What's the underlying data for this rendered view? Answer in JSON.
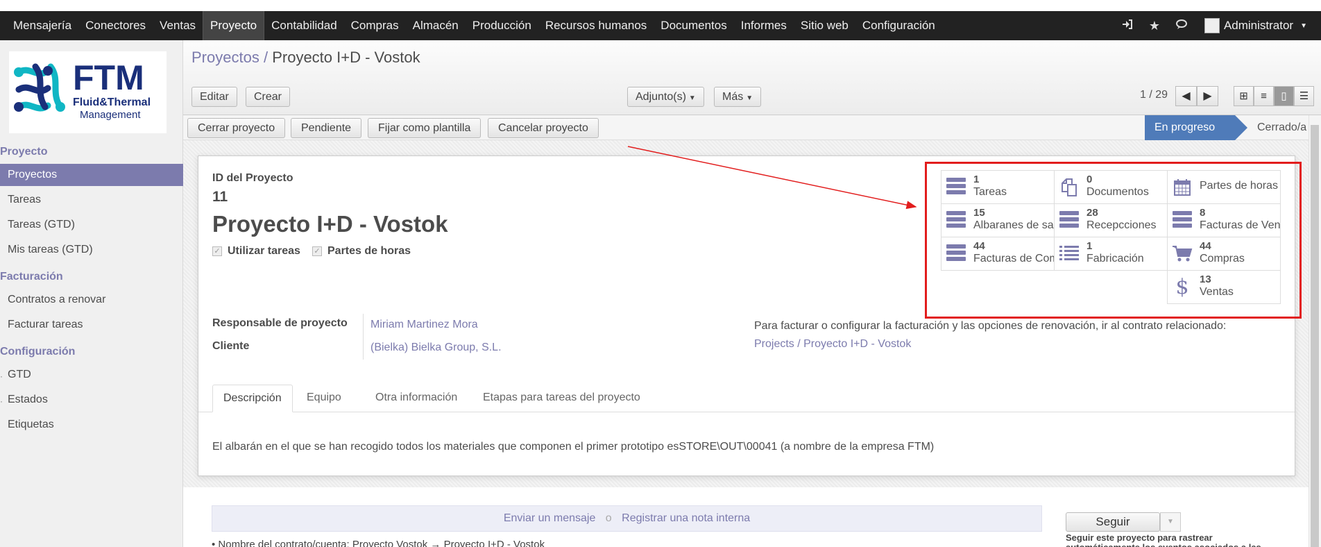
{
  "topbar": {
    "menu": [
      "Mensajería",
      "Conectores",
      "Ventas",
      "Proyecto",
      "Contabilidad",
      "Compras",
      "Almacén",
      "Producción",
      "Recursos humanos",
      "Documentos",
      "Informes",
      "Sitio web",
      "Configuración"
    ],
    "active_index": 3,
    "user": "Administrator"
  },
  "logo": {
    "title": "FTM",
    "line1": "Fluid&Thermal",
    "line2": "Management"
  },
  "sidebar": {
    "sections": [
      {
        "title": "Proyecto",
        "items": [
          "Proyectos",
          "Tareas",
          "Tareas (GTD)",
          "Mis tareas (GTD)"
        ]
      },
      {
        "title": "Facturación",
        "items": [
          "Contratos a renovar",
          "Facturar tareas"
        ]
      },
      {
        "title": "Configuración",
        "items": [
          "GTD",
          "Estados",
          "Etiquetas"
        ]
      }
    ]
  },
  "header": {
    "breadcrumb_parent": "Proyectos",
    "breadcrumb_sep": "/",
    "breadcrumb_current": "Proyecto I+D - Vostok",
    "edit_label": "Editar",
    "create_label": "Crear",
    "attachments_label": "Adjunto(s)",
    "more_label": "Más",
    "pager": "1 / 29"
  },
  "statusbar": {
    "buttons": [
      "Cerrar proyecto",
      "Pendiente",
      "Fijar como plantilla",
      "Cancelar proyecto"
    ],
    "stage_active": "En progreso",
    "stage_next": "Cerrado/a"
  },
  "form": {
    "id_label": "ID del Proyecto",
    "id_value": "11",
    "name": "Proyecto I+D - Vostok",
    "use_tasks_label": "Utilizar tareas",
    "timesheets_label": "Partes de horas",
    "manager_label": "Responsable de proyecto",
    "manager_value": "Miriam Martinez Mora",
    "customer_label": "Cliente",
    "customer_value": "(Bielka) Bielka Group, S.L.",
    "invoice_note": "Para facturar o configurar la facturación y las opciones de renovación, ir al contrato relacionado:",
    "contract_link": "Projects / Proyecto I+D - Vostok"
  },
  "smart_buttons": [
    {
      "num": "1",
      "label": "Tareas",
      "icon": "tasks-icon"
    },
    {
      "num": "0",
      "label": "Documentos",
      "icon": "documents-icon"
    },
    {
      "num": "",
      "label": "Partes de horas",
      "icon": "calendar-icon"
    },
    {
      "num": "15",
      "label": "Albaranes de salida",
      "icon": "tasks-icon"
    },
    {
      "num": "28",
      "label": "Recepcciones",
      "icon": "tasks-icon"
    },
    {
      "num": "8",
      "label": "Facturas de Venta",
      "icon": "tasks-icon"
    },
    {
      "num": "44",
      "label": "Facturas de Compra",
      "icon": "tasks-icon"
    },
    {
      "num": "1",
      "label": "Fabricación",
      "icon": "list-icon"
    },
    {
      "num": "44",
      "label": "Compras",
      "icon": "cart-icon"
    },
    {
      "num": "13",
      "label": "Ventas",
      "icon": "dollar-icon"
    }
  ],
  "tabs": [
    "Descripción",
    "Equipo",
    "Otra información",
    "Etapas para tareas del proyecto"
  ],
  "description": "El albarán en el que se han recogido todos los materiales que componen el primer prototipo es",
  "description_ref": "STORE\\OUT\\00041 (a nombre de la empresa FTM)",
  "chatter": {
    "send_message": "Enviar un mensaje",
    "separator": "o",
    "log_note": "Registrar una nota interna",
    "follow_label": "Seguir",
    "follow_hint": "Seguir este proyecto para rastrear automáticamente los eventos asociados a las",
    "first_line": "• Nombre del contrato/cuenta: Proyecto Vostok → Proyecto I+D - Vostok"
  },
  "colors": {
    "accent": "#7c7bad",
    "stage": "#4f7bb9",
    "highlight": "#e21d1d",
    "topbar": "#222222"
  }
}
